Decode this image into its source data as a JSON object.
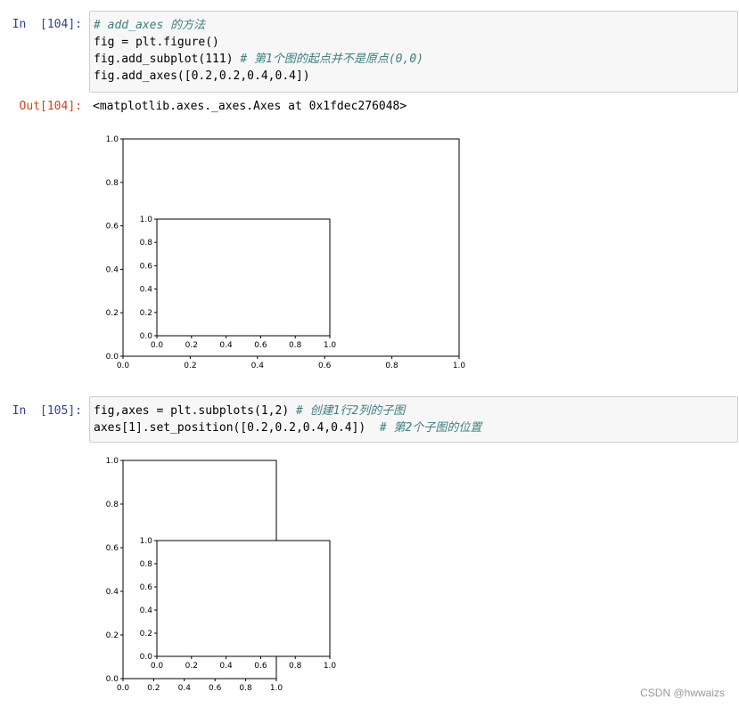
{
  "cells": [
    {
      "prompt_in": "In  [104]:",
      "prompt_out": "Out[104]:",
      "code": {
        "line1_comment": "# add_axes 的方法",
        "line2": "fig = plt.figure()",
        "line3_code": "fig.add_subplot(111)",
        "line3_comment": "# 第1个图的起点并不是原点(0,0)",
        "line4": "fig.add_axes([0.2,0.2,0.4,0.4])"
      },
      "output_text": "<matplotlib.axes._axes.Axes at 0x1fdec276048>"
    },
    {
      "prompt_in": "In  [105]:",
      "code": {
        "line1_code": "fig,axes = plt.subplots(1,2)",
        "line1_comment": "# 创建1行2列的子图",
        "line2_code": "axes[1].set_position([0.2,0.2,0.4,0.4])",
        "line2_comment": "# 第2个子图的位置"
      }
    }
  ],
  "chart_data": [
    {
      "type": "line",
      "description_from_code": "fig.add_subplot(111) with inset add_axes([0.2,0.2,0.4,0.4])",
      "axes": [
        {
          "xlim": [
            0,
            1
          ],
          "ylim": [
            0,
            1
          ],
          "xticks": [
            "0.0",
            "0.2",
            "0.4",
            "0.6",
            "0.8",
            "1.0"
          ],
          "yticks": [
            "0.0",
            "0.2",
            "0.4",
            "0.6",
            "0.8",
            "1.0"
          ]
        },
        {
          "xlim": [
            0,
            1
          ],
          "ylim": [
            0,
            1
          ],
          "xticks": [
            "0.0",
            "0.2",
            "0.4",
            "0.6",
            "0.8",
            "1.0"
          ],
          "yticks": [
            "0.0",
            "0.2",
            "0.4",
            "0.6",
            "0.8",
            "1.0"
          ]
        }
      ]
    },
    {
      "type": "line",
      "description_from_code": "plt.subplots(1,2) with axes[1] moved to [0.2,0.2,0.4,0.4]",
      "axes": [
        {
          "xlim": [
            0,
            1
          ],
          "ylim": [
            0,
            1
          ],
          "xticks": [
            "0.0",
            "0.2",
            "0.4",
            "0.6",
            "0.8",
            "1.0"
          ],
          "yticks": [
            "0.0",
            "0.2",
            "0.4",
            "0.6",
            "0.8",
            "1.0"
          ]
        },
        {
          "xlim": [
            0,
            1
          ],
          "ylim": [
            0,
            1
          ],
          "xticks": [
            "0.0",
            "0.2",
            "0.4",
            "0.6",
            "0.8",
            "1.0"
          ],
          "yticks": [
            "0.0",
            "0.2",
            "0.4",
            "0.6",
            "0.8",
            "1.0"
          ]
        }
      ]
    }
  ],
  "watermark": "CSDN @hwwaizs"
}
